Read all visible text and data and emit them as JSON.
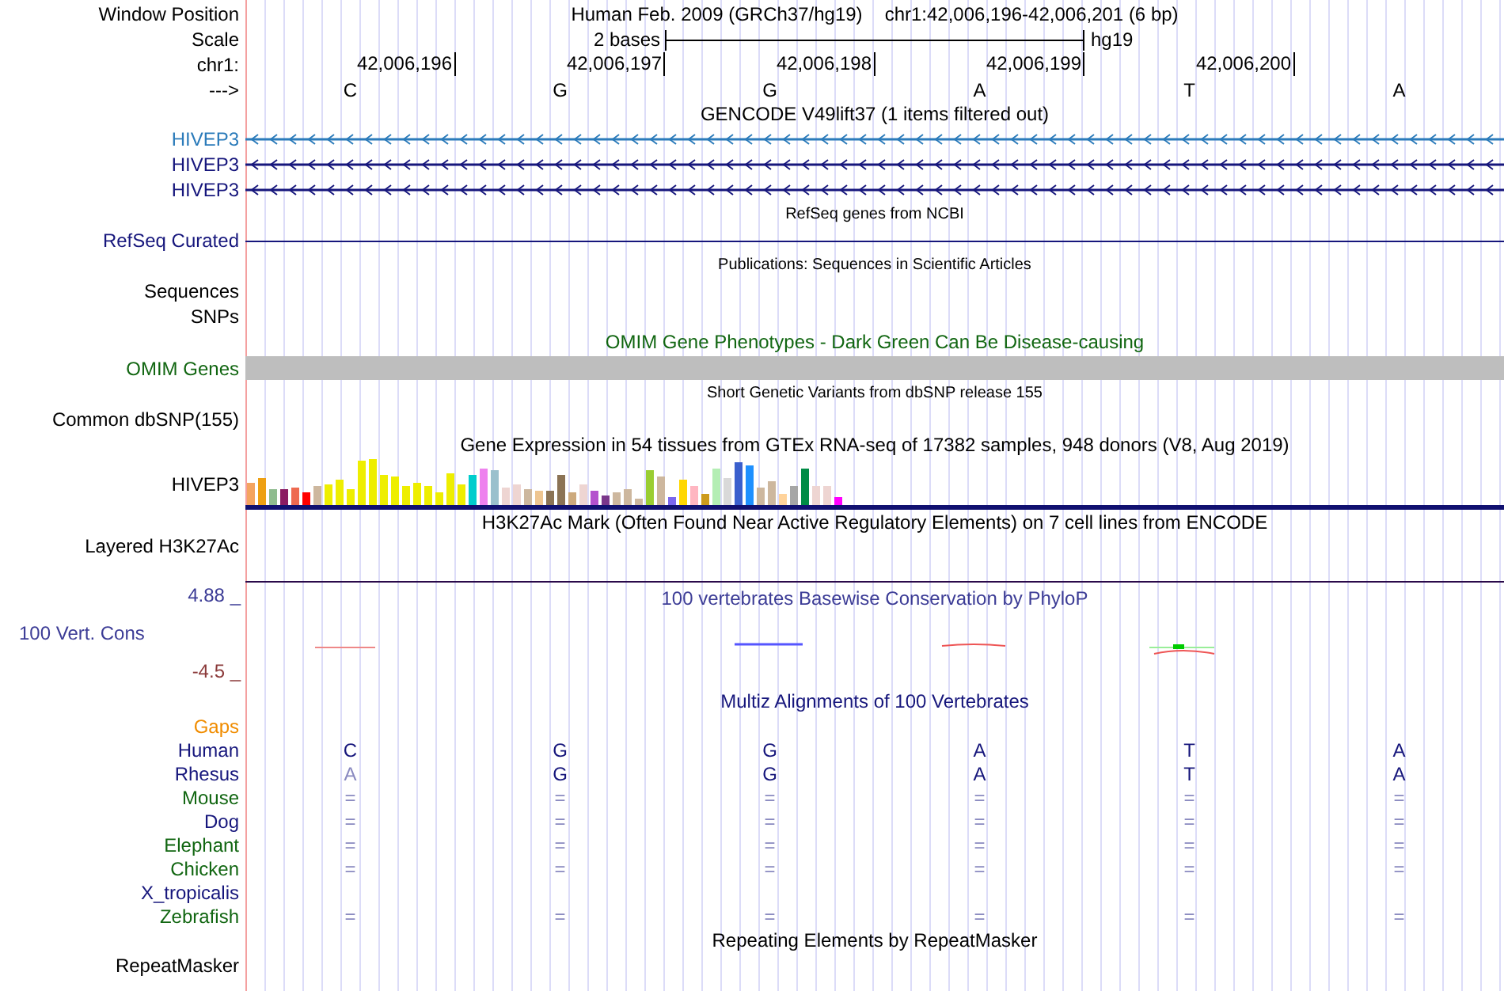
{
  "header": {
    "position": {
      "label": "Window Position",
      "assembly": "Human Feb. 2009 (GRCh37/hg19)",
      "range": "chr1:42,006,196-42,006,201 (6 bp)"
    },
    "scale": {
      "label": "Scale",
      "bar_label": "2 bases",
      "assembly_id": "hg19"
    },
    "ruler": {
      "label": "chr1:",
      "ticks": [
        "42,006,196",
        "42,006,197",
        "42,006,198",
        "42,006,199",
        "42,006,200"
      ]
    },
    "sequence": {
      "label": "--->",
      "bases": [
        "C",
        "G",
        "G",
        "A",
        "T",
        "A"
      ]
    }
  },
  "tracks": [
    {
      "kind": "gene",
      "title": {
        "text": "GENCODE V49lift37 (1 items filtered out)",
        "color": "#000000"
      },
      "rows": [
        {
          "label": "HIVEP3",
          "color": "#2b7bba"
        },
        {
          "label": "HIVEP3",
          "color": "#16167c"
        },
        {
          "label": "HIVEP3",
          "color": "#16167c"
        }
      ]
    },
    {
      "kind": "line",
      "title": {
        "text": "RefSeq genes from NCBI",
        "color": "#000000"
      },
      "rows": [
        {
          "label": "RefSeq Curated",
          "color": "#16167c"
        }
      ]
    },
    {
      "kind": "empty",
      "title": {
        "text": "Publications: Sequences in Scientific Articles",
        "color": "#000000"
      },
      "rows": [
        {
          "label": "Sequences",
          "color": "#000000"
        },
        {
          "label": "SNPs",
          "color": "#000000"
        }
      ]
    },
    {
      "kind": "block",
      "title": {
        "text": "OMIM Gene Phenotypes - Dark Green Can Be Disease-causing",
        "color": "#116611"
      },
      "rows": [
        {
          "label": "OMIM Genes",
          "color": "#116611"
        }
      ]
    },
    {
      "kind": "empty",
      "title": {
        "text": "Short Genetic Variants from dbSNP release 155",
        "color": "#000000"
      },
      "rows": [
        {
          "label": "Common dbSNP(155)",
          "color": "#000000"
        }
      ]
    },
    {
      "kind": "gtex",
      "title": {
        "text": "Gene Expression in 54 tissues from GTEx RNA-seq of 17382 samples, 948 donors (V8, Aug 2019)",
        "color": "#000000"
      },
      "rows": [
        {
          "label": "HIVEP3",
          "color": "#000000"
        }
      ]
    },
    {
      "kind": "layered",
      "title": {
        "text": "H3K27Ac Mark (Often Found Near Active Regulatory Elements) on 7 cell lines from ENCODE",
        "color": "#000000"
      },
      "rows": [
        {
          "label": "Layered H3K27Ac",
          "color": "#000000"
        }
      ]
    },
    {
      "kind": "phylop",
      "title": {
        "text": "100 vertebrates Basewise Conservation by PhyloP",
        "color": "#3c3c96"
      },
      "label": "100 Vert. Cons",
      "color": "#3c3c96",
      "max_label": "4.88 _",
      "min_label": "-4.5 _"
    },
    {
      "kind": "multiz",
      "title": {
        "text": "Multiz Alignments of 100 Vertebrates",
        "color": "#16167c"
      },
      "gaps_label": "Gaps",
      "species": [
        {
          "name": "Human",
          "color": "#16167c",
          "bases": [
            {
              "text": "C",
              "faded": false
            },
            {
              "text": "G",
              "faded": false
            },
            {
              "text": "G",
              "faded": false
            },
            {
              "text": "A",
              "faded": false
            },
            {
              "text": "T",
              "faded": false
            },
            {
              "text": "A",
              "faded": false
            }
          ]
        },
        {
          "name": "Rhesus",
          "color": "#16167c",
          "bases": [
            {
              "text": "A",
              "faded": true
            },
            {
              "text": "G",
              "faded": false
            },
            {
              "text": "G",
              "faded": false
            },
            {
              "text": "A",
              "faded": false
            },
            {
              "text": "T",
              "faded": false
            },
            {
              "text": "A",
              "faded": false
            }
          ]
        },
        {
          "name": "Mouse",
          "color": "#116611",
          "bases": [
            {
              "text": "=",
              "faded": true
            },
            {
              "text": "=",
              "faded": true
            },
            {
              "text": "=",
              "faded": true
            },
            {
              "text": "=",
              "faded": true
            },
            {
              "text": "=",
              "faded": true
            },
            {
              "text": "=",
              "faded": true
            }
          ]
        },
        {
          "name": "Dog",
          "color": "#16167c",
          "bases": [
            {
              "text": "=",
              "faded": true
            },
            {
              "text": "=",
              "faded": true
            },
            {
              "text": "=",
              "faded": true
            },
            {
              "text": "=",
              "faded": true
            },
            {
              "text": "=",
              "faded": true
            },
            {
              "text": "=",
              "faded": true
            }
          ]
        },
        {
          "name": "Elephant",
          "color": "#116611",
          "bases": [
            {
              "text": "=",
              "faded": true
            },
            {
              "text": "=",
              "faded": true
            },
            {
              "text": "=",
              "faded": true
            },
            {
              "text": "=",
              "faded": true
            },
            {
              "text": "=",
              "faded": true
            },
            {
              "text": "=",
              "faded": true
            }
          ]
        },
        {
          "name": "Chicken",
          "color": "#116611",
          "bases": [
            {
              "text": "=",
              "faded": true
            },
            {
              "text": "=",
              "faded": true
            },
            {
              "text": "=",
              "faded": true
            },
            {
              "text": "=",
              "faded": true
            },
            {
              "text": "=",
              "faded": true
            },
            {
              "text": "=",
              "faded": true
            }
          ]
        },
        {
          "name": "X_tropicalis",
          "color": "#16167c"
        },
        {
          "name": "Zebrafish",
          "color": "#116611",
          "bases": [
            {
              "text": "=",
              "faded": true
            },
            {
              "text": "=",
              "faded": true
            },
            {
              "text": "=",
              "faded": true
            },
            {
              "text": "=",
              "faded": true
            },
            {
              "text": "=",
              "faded": true
            },
            {
              "text": "=",
              "faded": true
            }
          ]
        }
      ]
    },
    {
      "kind": "repeat",
      "title": {
        "text": "Repeating Elements by RepeatMasker",
        "color": "#000000"
      },
      "rows": [
        {
          "label": "RepeatMasker",
          "color": "#000000"
        }
      ]
    }
  ]
}
